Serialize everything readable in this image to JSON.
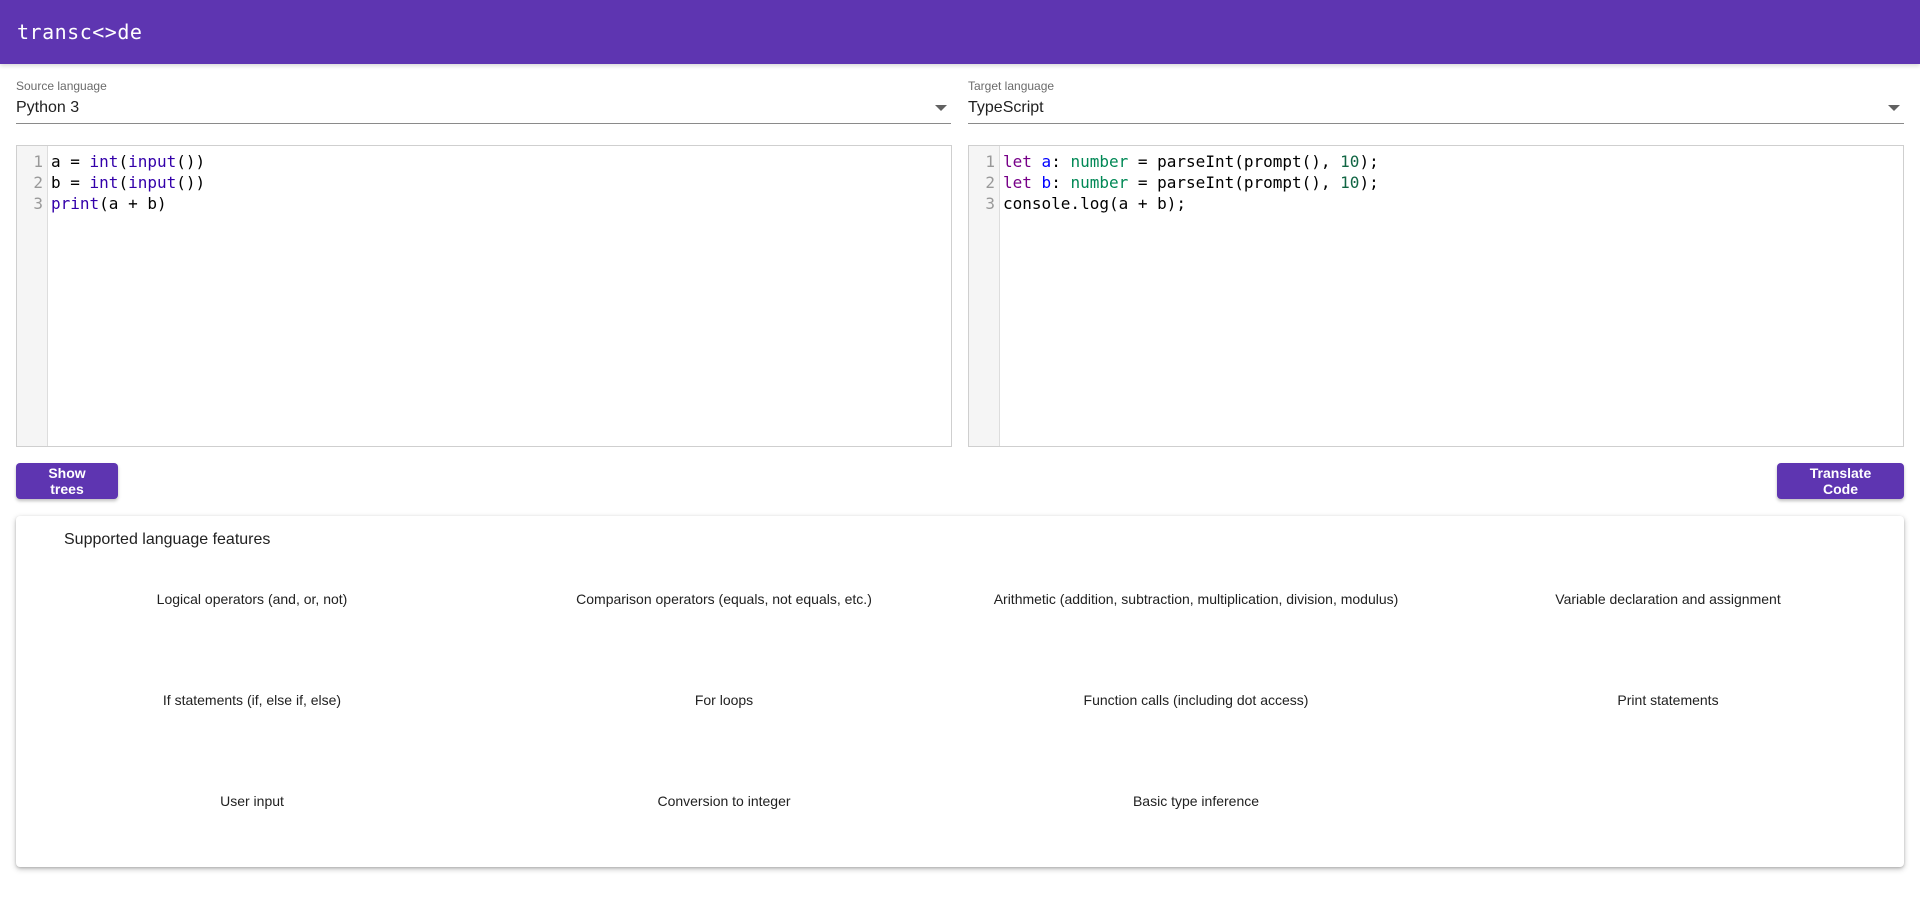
{
  "app": {
    "title": "transc<>de",
    "brand_color": "#5e35b1"
  },
  "source": {
    "label": "Source language",
    "value": "Python 3",
    "code_lines": [
      [
        {
          "t": "a = ",
          "c": ""
        },
        {
          "t": "int",
          "c": "fn"
        },
        {
          "t": "(",
          "c": ""
        },
        {
          "t": "input",
          "c": "fn"
        },
        {
          "t": "())",
          "c": ""
        }
      ],
      [
        {
          "t": "b = ",
          "c": ""
        },
        {
          "t": "int",
          "c": "fn"
        },
        {
          "t": "(",
          "c": ""
        },
        {
          "t": "input",
          "c": "fn"
        },
        {
          "t": "())",
          "c": ""
        }
      ],
      [
        {
          "t": "print",
          "c": "fn"
        },
        {
          "t": "(a + b)",
          "c": ""
        }
      ]
    ]
  },
  "target": {
    "label": "Target language",
    "value": "TypeScript",
    "code_lines": [
      [
        {
          "t": "let",
          "c": "kw"
        },
        {
          "t": " ",
          "c": ""
        },
        {
          "t": "a",
          "c": "def"
        },
        {
          "t": ": ",
          "c": ""
        },
        {
          "t": "number",
          "c": "ty"
        },
        {
          "t": " = parseInt(prompt(), ",
          "c": ""
        },
        {
          "t": "10",
          "c": "num"
        },
        {
          "t": ");",
          "c": ""
        }
      ],
      [
        {
          "t": "let",
          "c": "kw"
        },
        {
          "t": " ",
          "c": ""
        },
        {
          "t": "b",
          "c": "def"
        },
        {
          "t": ": ",
          "c": ""
        },
        {
          "t": "number",
          "c": "ty"
        },
        {
          "t": " = parseInt(prompt(), ",
          "c": ""
        },
        {
          "t": "10",
          "c": "num"
        },
        {
          "t": ");",
          "c": ""
        }
      ],
      [
        {
          "t": "console.log(a + b);",
          "c": ""
        }
      ]
    ]
  },
  "buttons": {
    "show_trees": "Show trees",
    "translate": "Translate Code"
  },
  "features": {
    "title": "Supported language features",
    "items": [
      "Logical operators (and, or, not)",
      "Comparison operators (equals, not equals, etc.)",
      "Arithmetic (addition, subtraction, multiplication, division, modulus)",
      "Variable declaration and assignment",
      "If statements (if, else if, else)",
      "For loops",
      "Function calls (including dot access)",
      "Print statements",
      "User input",
      "Conversion to integer",
      "Basic type inference"
    ]
  }
}
